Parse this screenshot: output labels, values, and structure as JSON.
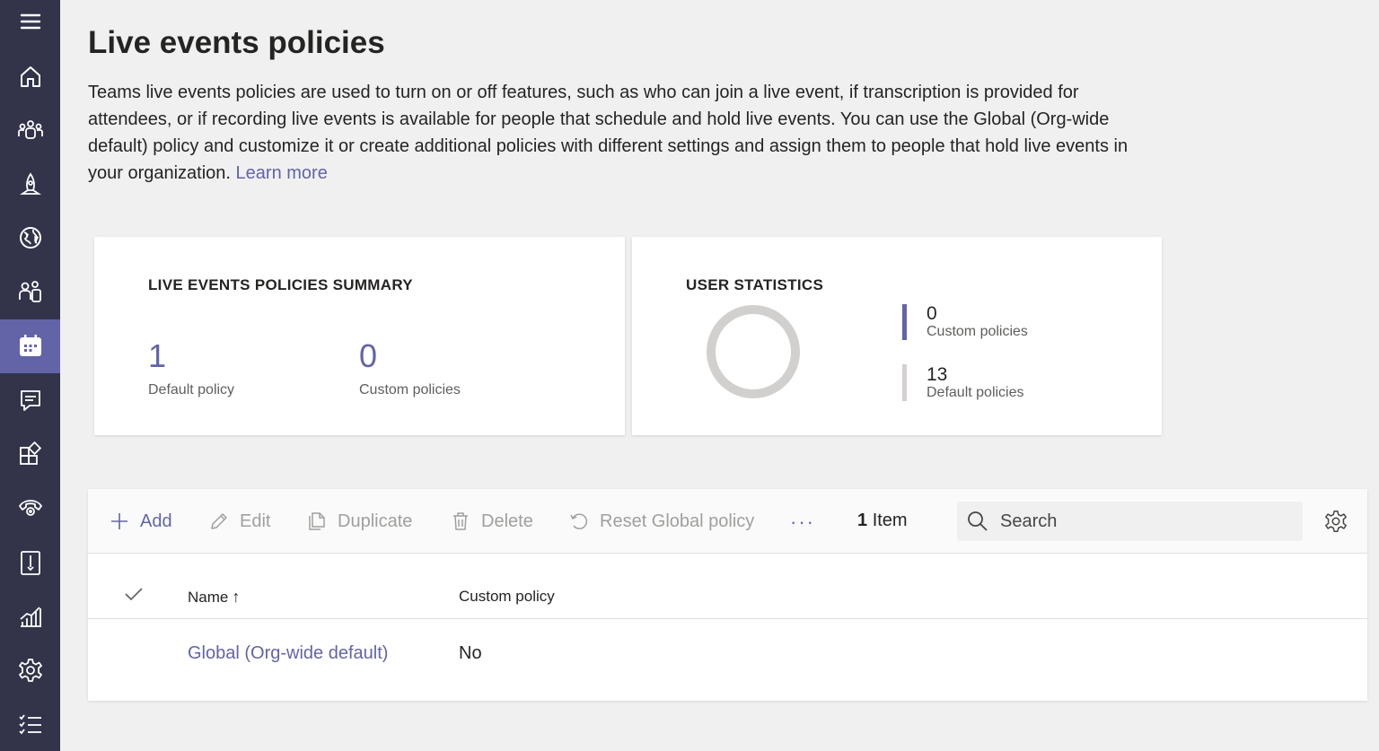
{
  "rail": {
    "items": [
      {
        "icon": "hamburger-icon"
      },
      {
        "icon": "home-icon"
      },
      {
        "icon": "teams-icon"
      },
      {
        "icon": "devices-icon"
      },
      {
        "icon": "locations-icon"
      },
      {
        "icon": "users-icon"
      },
      {
        "icon": "meetings-icon",
        "active": true
      },
      {
        "icon": "messaging-icon"
      },
      {
        "icon": "apps-icon"
      },
      {
        "icon": "voice-icon"
      },
      {
        "icon": "policy-packages-icon"
      },
      {
        "icon": "analytics-icon"
      },
      {
        "icon": "settings-icon"
      },
      {
        "icon": "planning-icon"
      }
    ]
  },
  "header": {
    "title": "Live events policies",
    "description": "Teams live events policies are used to turn on or off features, such as who can join a live event, if transcription is provided for attendees, or if recording live events is available for people that schedule and hold live events. You can use the Global (Org-wide default) policy and customize it or create additional policies with different settings and assign them to people that hold live events in your organization. ",
    "learn_more": "Learn more"
  },
  "summary_card": {
    "title": "LIVE EVENTS POLICIES SUMMARY",
    "default_count": "1",
    "default_label": "Default policy",
    "custom_count": "0",
    "custom_label": "Custom policies"
  },
  "stats_card": {
    "title": "USER STATISTICS",
    "custom_count": "0",
    "custom_label": "Custom policies",
    "default_count": "13",
    "default_label": "Default policies",
    "custom_color": "#6264a7",
    "default_color": "#d2d0ce"
  },
  "toolbar": {
    "add": "Add",
    "edit": "Edit",
    "duplicate": "Duplicate",
    "delete": "Delete",
    "reset": "Reset Global policy",
    "more": "···",
    "item_count": "1",
    "item_label": "Item",
    "search_placeholder": "Search"
  },
  "table": {
    "columns": [
      "Name",
      "Custom policy"
    ],
    "sort_indicator": "↑",
    "rows": [
      {
        "name": "Global (Org-wide default)",
        "custom_policy": "No"
      }
    ]
  },
  "colors": {
    "accent": "#6264a7",
    "rail_bg": "#33344a",
    "page_bg": "#f0f0f0"
  }
}
